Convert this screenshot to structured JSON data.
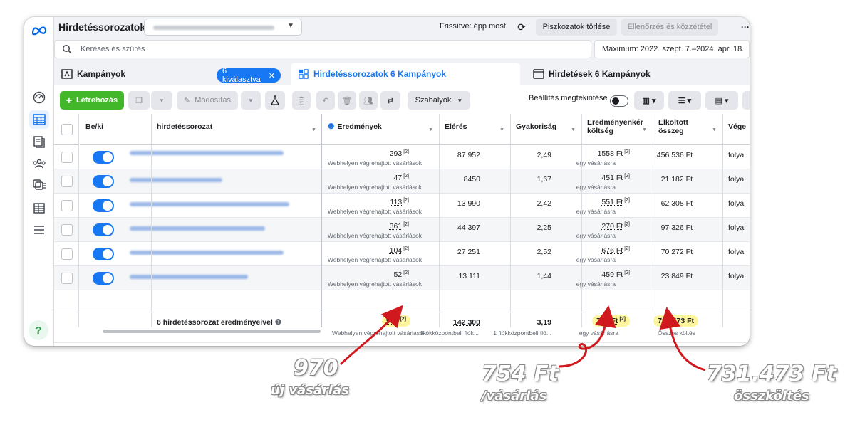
{
  "app": {
    "title": "Hirdetéssorozatok",
    "refresh_status": "Frissítve: épp most",
    "discard_drafts": "Piszkozatok törlése",
    "review_publish": "Ellenőrzés és közzététel",
    "more": "···"
  },
  "search": {
    "placeholder": "Keresés és szűrés",
    "date_range": "Maximum: 2022. szept. 7.–2024. ápr. 18."
  },
  "tabs": [
    {
      "label": "Kampányok",
      "badge": "6 kiválasztva",
      "badge_close": "✕"
    },
    {
      "label": "Hirdetéssorozatok 6 Kampányok"
    },
    {
      "label": "Hirdetések 6 Kampányok"
    }
  ],
  "toolbar": {
    "create": "Létrehozás",
    "edit": "Módosítás",
    "rules": "Szabályok",
    "view_setup": "Beállítás megtekintése"
  },
  "columns": {
    "onoff": "Be/ki",
    "name": "hirdetéssorozat",
    "results": "Eredmények",
    "reach": "Elérés",
    "frequency": "Gyakoriság",
    "cost_per_result": "Eredményenkér költség",
    "amount_spent": "Elköltött összeg",
    "end": "Vége"
  },
  "rows": [
    {
      "results": "293",
      "results_sub": "Webhelyen végrehajtott vásárlások",
      "reach": "87 952",
      "frequency": "2,49",
      "cpr": "1558 Ft",
      "cpr_sub": "egy vásárlásra",
      "spent": "456 536 Ft",
      "end": "folya"
    },
    {
      "results": "47",
      "results_sub": "Webhelyen végrehajtott vásárlások",
      "reach": "8450",
      "frequency": "1,67",
      "cpr": "451 Ft",
      "cpr_sub": "egy vásárlásra",
      "spent": "21 182 Ft",
      "end": "folya"
    },
    {
      "results": "113",
      "results_sub": "Webhelyen végrehajtott vásárlások",
      "reach": "13 990",
      "frequency": "2,42",
      "cpr": "551 Ft",
      "cpr_sub": "egy vásárlásra",
      "spent": "62 308 Ft",
      "end": "folya"
    },
    {
      "results": "361",
      "results_sub": "Webhelyen végrehajtott vásárlások",
      "reach": "44 397",
      "frequency": "2,25",
      "cpr": "270 Ft",
      "cpr_sub": "egy vásárlásra",
      "spent": "97 326 Ft",
      "end": "folya"
    },
    {
      "results": "104",
      "results_sub": "Webhelyen végrehajtott vásárlások",
      "reach": "27 251",
      "frequency": "2,52",
      "cpr": "676 Ft",
      "cpr_sub": "egy vásárlásra",
      "spent": "70 272 Ft",
      "end": "folya"
    },
    {
      "results": "52",
      "results_sub": "Webhelyen végrehajtott vásárlások",
      "reach": "13 111",
      "frequency": "1,44",
      "cpr": "459 Ft",
      "cpr_sub": "egy vásárlásra",
      "spent": "23 849 Ft",
      "end": "folya"
    }
  ],
  "total": {
    "label": "6 hirdetéssorozat eredményeivel",
    "results": "970",
    "results_sub": "Webhelyen végrehajtott vásárlások",
    "reach": "142 300",
    "reach_sub": "Fiókközpontbeli fiók...",
    "frequency": "3,19",
    "frequency_sub": "1 fiókközpontbeli fió...",
    "cpr": "754 Ft",
    "cpr_sub": "egy vásárlásra",
    "spent": "731 473 Ft",
    "spent_sub": "Összes költés"
  },
  "sup": "[2]",
  "annotations": [
    {
      "big": "970",
      "small": "új vásárlás"
    },
    {
      "big": "754 Ft",
      "small": "/vásárlás"
    },
    {
      "big": "731.473 Ft",
      "small": "összköltés"
    }
  ],
  "colors": {
    "accent": "#1877f2",
    "create": "#42b72a",
    "highlight": "#fff59d",
    "arrow": "#d0191f"
  }
}
